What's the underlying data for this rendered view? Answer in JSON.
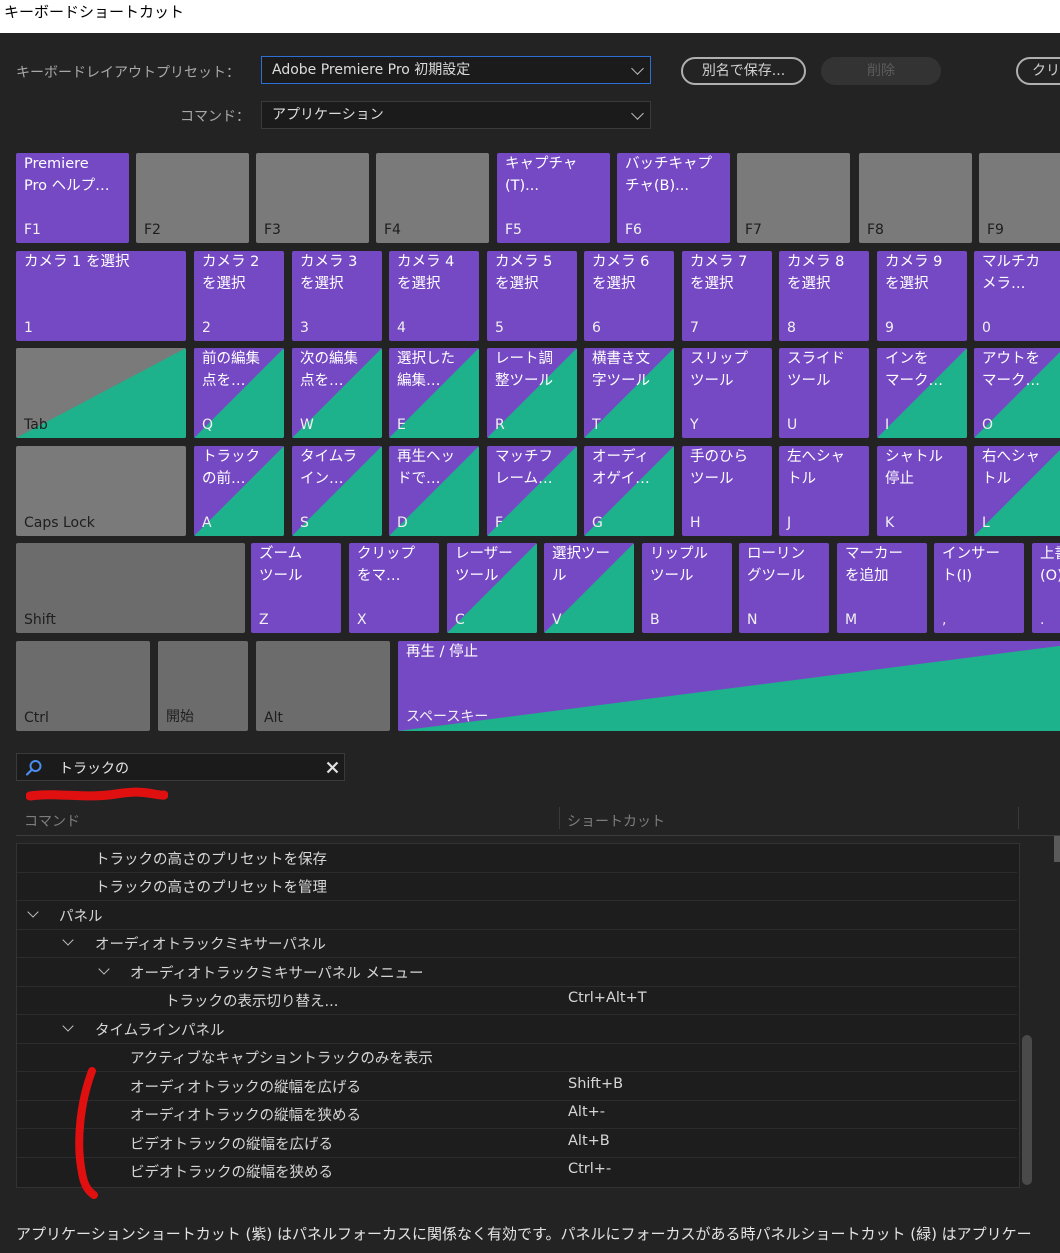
{
  "window": {
    "title": "キーボードショートカット"
  },
  "preset": {
    "label": "キーボードレイアウトプリセット：",
    "value": "Adobe Premiere Pro 初期設定",
    "save_as": "別名で保存...",
    "delete": "削除",
    "clear": "クリ"
  },
  "command": {
    "label": "コマンド：",
    "value": "アプリケーション"
  },
  "keys": {
    "r1": [
      {
        "cmd": "Premiere\nPro ヘルプ…",
        "key": "F1",
        "style": "purple"
      },
      {
        "cmd": "",
        "key": "F2",
        "style": "gray"
      },
      {
        "cmd": "",
        "key": "F3",
        "style": "gray"
      },
      {
        "cmd": "",
        "key": "F4",
        "style": "gray"
      },
      {
        "cmd": "キャプチャ\n(T)...",
        "key": "F5",
        "style": "purple"
      },
      {
        "cmd": "バッチキャプ\nチャ(B)...",
        "key": "F6",
        "style": "purple"
      },
      {
        "cmd": "",
        "key": "F7",
        "style": "gray"
      },
      {
        "cmd": "",
        "key": "F8",
        "style": "gray"
      },
      {
        "cmd": "",
        "key": "F9",
        "style": "gray"
      }
    ],
    "r2": [
      {
        "cmd": "カメラ 1 を選択",
        "key": "1",
        "style": "purple"
      },
      {
        "cmd": "カメラ 2\nを選択",
        "key": "2",
        "style": "purple"
      },
      {
        "cmd": "カメラ 3\nを選択",
        "key": "3",
        "style": "purple"
      },
      {
        "cmd": "カメラ 4\nを選択",
        "key": "4",
        "style": "purple"
      },
      {
        "cmd": "カメラ 5\nを選択",
        "key": "5",
        "style": "purple"
      },
      {
        "cmd": "カメラ 6\nを選択",
        "key": "6",
        "style": "purple"
      },
      {
        "cmd": "カメラ 7\nを選択",
        "key": "7",
        "style": "purple"
      },
      {
        "cmd": "カメラ 8\nを選択",
        "key": "8",
        "style": "purple"
      },
      {
        "cmd": "カメラ 9\nを選択",
        "key": "9",
        "style": "purple"
      },
      {
        "cmd": "マルチカ\nメラ…",
        "key": "0",
        "style": "purple"
      }
    ],
    "r3": [
      {
        "cmd": "",
        "key": "Tab",
        "style": "gray-split"
      },
      {
        "cmd": "前の編集\n点を…",
        "key": "Q",
        "style": "split"
      },
      {
        "cmd": "次の編集\n点を…",
        "key": "W",
        "style": "split"
      },
      {
        "cmd": "選択した\n編集…",
        "key": "E",
        "style": "split"
      },
      {
        "cmd": "レート調\n整ツール",
        "key": "R",
        "style": "split"
      },
      {
        "cmd": "横書き文\n字ツール",
        "key": "T",
        "style": "split"
      },
      {
        "cmd": "スリップ\nツール",
        "key": "Y",
        "style": "purple"
      },
      {
        "cmd": "スライド\nツール",
        "key": "U",
        "style": "purple"
      },
      {
        "cmd": "インを\nマーク…",
        "key": "I",
        "style": "split"
      },
      {
        "cmd": "アウトを\nマーク…",
        "key": "O",
        "style": "split"
      }
    ],
    "r4": [
      {
        "cmd": "",
        "key": "Caps Lock",
        "style": "gray"
      },
      {
        "cmd": "トラック\nの前…",
        "key": "A",
        "style": "split"
      },
      {
        "cmd": "タイムラ\nイン…",
        "key": "S",
        "style": "split"
      },
      {
        "cmd": "再生ヘッ\nドで…",
        "key": "D",
        "style": "split"
      },
      {
        "cmd": "マッチフ\nレーム…",
        "key": "F",
        "style": "split"
      },
      {
        "cmd": "オーディ\nオゲイ…",
        "key": "G",
        "style": "split"
      },
      {
        "cmd": "手のひら\nツール",
        "key": "H",
        "style": "purple"
      },
      {
        "cmd": "左へシャ\nトル",
        "key": "J",
        "style": "purple"
      },
      {
        "cmd": "シャトル\n停止",
        "key": "K",
        "style": "purple"
      },
      {
        "cmd": "右へシャ\nトル",
        "key": "L",
        "style": "split"
      }
    ],
    "r5": [
      {
        "cmd": "",
        "key": "Shift",
        "style": "gray2"
      },
      {
        "cmd": "ズーム\nツール",
        "key": "Z",
        "style": "purple"
      },
      {
        "cmd": "クリップ\nをマ…",
        "key": "X",
        "style": "purple"
      },
      {
        "cmd": "レーザー\nツール",
        "key": "C",
        "style": "split"
      },
      {
        "cmd": "選択ツー\nル",
        "key": "V",
        "style": "split"
      },
      {
        "cmd": "リップル\nツール",
        "key": "B",
        "style": "purple"
      },
      {
        "cmd": "ローリン\nグツール",
        "key": "N",
        "style": "purple"
      },
      {
        "cmd": "マーカー\nを追加",
        "key": "M",
        "style": "purple"
      },
      {
        "cmd": "インサー\nト(I)",
        "key": ",",
        "style": "purple"
      },
      {
        "cmd": "上書\n(O)",
        "key": ".",
        "style": "purple"
      }
    ],
    "r6": [
      {
        "cmd": "",
        "key": "Ctrl",
        "style": "gray2"
      },
      {
        "cmd": "",
        "key": "開始",
        "style": "gray2"
      },
      {
        "cmd": "",
        "key": "Alt",
        "style": "gray2"
      },
      {
        "cmd": "再生 / 停止",
        "key": "スペースキー",
        "style": "split"
      }
    ]
  },
  "search": {
    "value": "トラックの"
  },
  "table": {
    "col_command": "コマンド",
    "col_shortcut": "ショートカット"
  },
  "rows": [
    {
      "text": "トラックの高さのプリセットを保存",
      "shortcut": ""
    },
    {
      "text": "トラックの高さのプリセットを管理",
      "shortcut": ""
    },
    {
      "text": "パネル",
      "shortcut": ""
    },
    {
      "text": "オーディオトラックミキサーパネル",
      "shortcut": ""
    },
    {
      "text": "オーディオトラックミキサーパネル メニュー",
      "shortcut": ""
    },
    {
      "text": "トラックの表示切り替え...",
      "shortcut": "Ctrl+Alt+T"
    },
    {
      "text": "タイムラインパネル",
      "shortcut": ""
    },
    {
      "text": "アクティブなキャプショントラックのみを表示",
      "shortcut": ""
    },
    {
      "text": "オーディオトラックの縦幅を広げる",
      "shortcut": "Shift+B"
    },
    {
      "text": "オーディオトラックの縦幅を狭める",
      "shortcut": "Alt+-"
    },
    {
      "text": "ビデオトラックの縦幅を広げる",
      "shortcut": "Alt+B"
    },
    {
      "text": "ビデオトラックの縦幅を狭める",
      "shortcut": "Ctrl+-"
    }
  ],
  "footer": "アプリケーションショートカット (紫) はパネルフォーカスに関係なく有効です。パネルにフォーカスがある時パネルショートカット (緑) はアプリケー",
  "colors": {
    "purple": "#7649c4",
    "green": "#1db28b",
    "key_gray": "#7a7a7a",
    "bg": "#232323"
  }
}
